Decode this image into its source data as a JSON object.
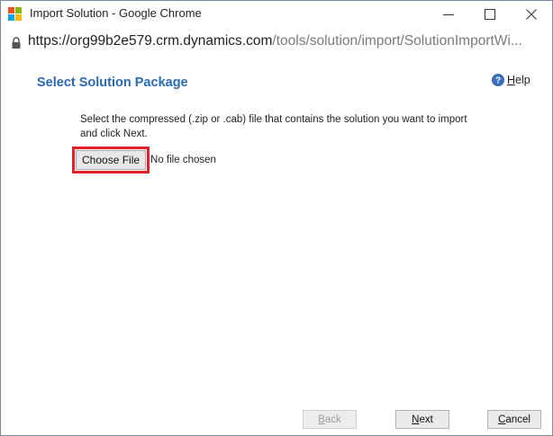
{
  "window": {
    "title": "Import Solution - Google Chrome",
    "controls": {
      "minimize_glyph": "—",
      "maximize_glyph": "☐",
      "close_glyph": "✕"
    }
  },
  "address_bar": {
    "scheme": "https://",
    "host": "org99b2e579.crm.dynamics.com",
    "path": "/tools/solution/import/SolutionImportWi...",
    "icon": "lock-icon"
  },
  "page": {
    "title": "Select Solution Package",
    "help": {
      "accel": "H",
      "rest": "elp",
      "icon": "question-circle-icon"
    },
    "instructions": "Select the compressed (.zip or .cab) file that contains the solution you want to import and click Next.",
    "file_input": {
      "button_label": "Choose File",
      "status": "No file chosen",
      "highlighted": true
    }
  },
  "footer": {
    "back": {
      "accel": "B",
      "rest": "ack",
      "enabled": false
    },
    "next": {
      "accel": "N",
      "rest": "ext",
      "enabled": true
    },
    "cancel": {
      "accel": "C",
      "rest": "ancel",
      "enabled": true
    }
  },
  "colors": {
    "title_blue": "#2b68b4",
    "highlight_red": "#e0202a",
    "logo": [
      "#f25022",
      "#7fba00",
      "#00a4ef",
      "#ffb900"
    ]
  }
}
